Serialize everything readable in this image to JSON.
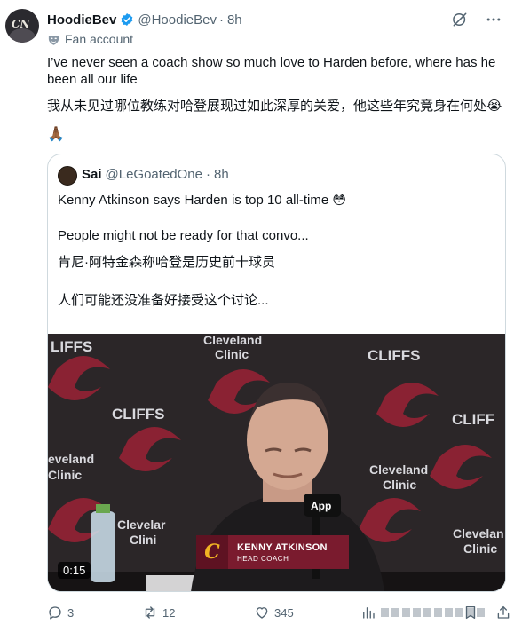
{
  "author": {
    "name": "HoodieBev",
    "handle": "@HoodieBev",
    "time": "8h",
    "avatar_text": "CN",
    "label": "Fan account"
  },
  "tweet": {
    "text_en": "I’ve never seen a coach show so much love to Harden before, where has he been all our life",
    "text_zh": "我从未见过哪位教练对哈登展现过如此深厚的关爱，他这些年究竟身在何处😭",
    "emoji_line": "🙏🏾"
  },
  "quote": {
    "name": "Sai",
    "handle": "@LeGoatedOne",
    "time": "8h",
    "line1": "Kenny Atkinson says Harden is top 10 all-time 😳",
    "line2": "People might not be ready for that convo...",
    "line3": "肯尼·阿特金森称哈登是历史前十球员",
    "line4": "人们可能还没准备好接受这个讨论..."
  },
  "video": {
    "duration": "0:15",
    "lower_third_name": "KENNY ATKINSON",
    "lower_third_role": "HEAD COACH",
    "backdrop": {
      "sponsor_1": "CLIFFS",
      "sponsor_2": "Cleveland Clinic"
    },
    "mic_label": "App"
  },
  "actions": {
    "replies": "3",
    "retweets": "12",
    "likes": "345"
  },
  "colors": {
    "verified": "#1d9bf0",
    "secondary_text": "#536471",
    "cavs_wine": "#7a1b2e",
    "cavs_gold": "#f0b323"
  },
  "icons": {
    "verified": "verified-badge-icon",
    "grok": "grok-icon",
    "more": "more-icon",
    "fan": "mask-icon",
    "reply": "reply-icon",
    "retweet": "retweet-icon",
    "like": "heart-icon",
    "views": "views-icon",
    "bookmark": "bookmark-icon",
    "share": "share-icon"
  }
}
